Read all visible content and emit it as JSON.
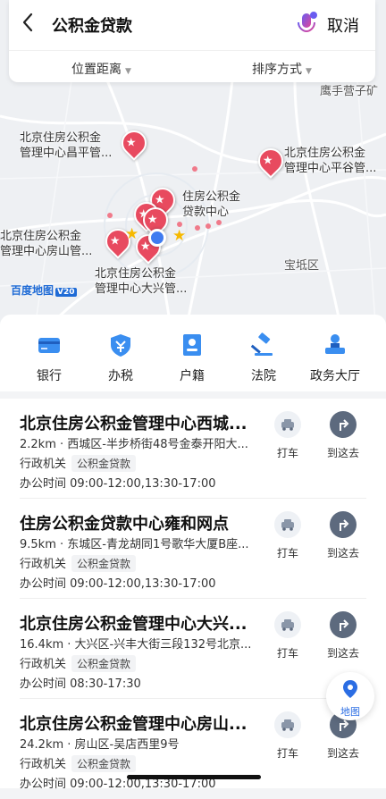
{
  "header": {
    "back": "‹",
    "title": "公积金贷款",
    "cancel": "取消"
  },
  "filters": {
    "distance": "位置距离",
    "sort": "排序方式"
  },
  "map": {
    "labels": {
      "yingshou": "鹰手营子矿",
      "changping": [
        "北京住房公积金",
        "管理中心昌平管..."
      ],
      "pinggu": [
        "北京住房公积金",
        "管理中心平谷管..."
      ],
      "center": [
        "住房公积金",
        "贷款中心"
      ],
      "fangshan": [
        "北京住房公积金",
        "管理中心房山管..."
      ],
      "daxing": [
        "北京住房公积金",
        "管理中心大兴管..."
      ],
      "baodi": "宝坻区"
    },
    "logo_text": "百度地图",
    "logo_version": "V20"
  },
  "categories": [
    {
      "label": "银行",
      "icon": "bank-card-icon"
    },
    {
      "label": "办税",
      "icon": "tax-shield-icon"
    },
    {
      "label": "户籍",
      "icon": "household-register-icon"
    },
    {
      "label": "法院",
      "icon": "court-gavel-icon"
    },
    {
      "label": "政务大厅",
      "icon": "government-hall-icon"
    }
  ],
  "results": [
    {
      "name": "北京住房公积金管理中心西城...",
      "addr": "2.2km · 西城区-半步桥街48号金泰开阳大...",
      "type": "行政机关",
      "tag": "公积金贷款",
      "hours": "办公时间 09:00-12:00,13:30-17:00"
    },
    {
      "name": "住房公积金贷款中心雍和网点",
      "addr": "9.5km · 东城区-青龙胡同1号歌华大厦B座...",
      "type": "行政机关",
      "tag": "公积金贷款",
      "hours": "办公时间 09:00-12:00,13:30-17:00"
    },
    {
      "name": "北京住房公积金管理中心大兴...",
      "addr": "16.4km · 大兴区-兴丰大街三段132号北京...",
      "type": "行政机关",
      "tag": "公积金贷款",
      "hours": "办公时间 08:30-17:30"
    },
    {
      "name": "北京住房公积金管理中心房山...",
      "addr": "24.2km · 房山区-吴店西里9号",
      "type": "行政机关",
      "tag": "公积金贷款",
      "hours": "办公时间 09:00-12:00,13:30-17:00"
    }
  ],
  "actions": {
    "taxi": "打车",
    "go": "到这去"
  },
  "fab": {
    "label": "地图"
  },
  "colors": {
    "accent": "#2b6de3",
    "pin": "#e84a5f",
    "star": "#f6b900"
  }
}
